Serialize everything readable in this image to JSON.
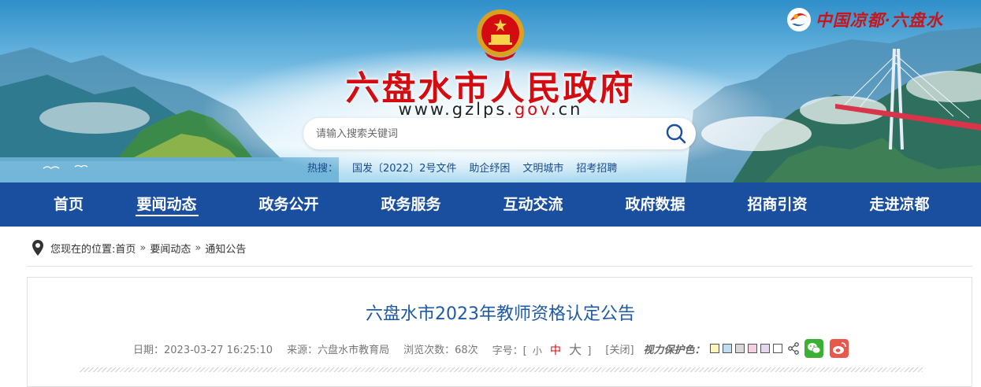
{
  "header": {
    "site_title": "六盘水市人民政府",
    "url_prefix": "www.gzlps.",
    "url_domain": "gov",
    "url_suffix": ".cn",
    "brand_text": "中国凉都·六盘水",
    "search": {
      "placeholder": "请输入搜索关键词"
    },
    "hot": {
      "label": "热搜：",
      "items": [
        "国发〔2022〕2号文件",
        "助企纾困",
        "文明城市",
        "招考招聘"
      ]
    }
  },
  "nav": {
    "items": [
      "首页",
      "要闻动态",
      "政务公开",
      "政务服务",
      "互动交流",
      "政府数据",
      "招商引资",
      "走进凉都"
    ],
    "active_index": 1
  },
  "breadcrumb": {
    "prefix": "您现在的位置:",
    "items": [
      "首页",
      "要闻动态",
      "通知公告"
    ],
    "separator": "»"
  },
  "article": {
    "title": "六盘水市2023年教师资格认定公告",
    "date": "日期：2023-03-27 16:25:10",
    "source": "来源：六盘水市教育局",
    "views": "浏览次数：68次",
    "font_label": "字号：[",
    "font_small": "小",
    "font_medium": "中",
    "font_large": "大",
    "font_end": "]",
    "close": "[关闭]",
    "eye_label": "视力保护色：",
    "swatches": [
      "#fdf5bd",
      "#bfdcf0",
      "#d8d8d8",
      "#f4cfe0",
      "#e4d7f0",
      "#ffffff"
    ]
  },
  "colors": {
    "nav_bg": "#1a4f9f",
    "title_red": "#d40b10",
    "article_title": "#1f5aa6",
    "wechat": "#3cb034",
    "weibo": "#e8584b"
  }
}
